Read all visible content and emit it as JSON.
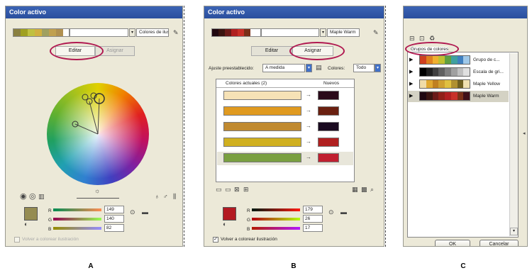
{
  "captions": {
    "a": "A",
    "b": "B",
    "c": "C"
  },
  "panelA": {
    "title": "Color activo",
    "group_name": "Colores de ilustra",
    "tab_edit": "Editar",
    "tab_assign": "Asignar",
    "r_label": "R",
    "g_label": "G",
    "b_label": "B",
    "r_value": "149",
    "g_value": "140",
    "b_value": "82",
    "recolor_label": "Volver a colorear ilustración",
    "base_color": "#958c52"
  },
  "panelB": {
    "title": "Color activo",
    "group_name": "Maple Warm",
    "tab_edit": "Editar",
    "tab_assign": "Asignar",
    "preset_label": "Ajuste preestablecido:",
    "preset_value": "A medida",
    "colors_label": "Colores:",
    "colors_value": "Todo",
    "col_current": "Colores actuales (2)",
    "col_new": "Nuevos",
    "rows": [
      {
        "current": "#f6e2b6",
        "new": "#2a0a1a"
      },
      {
        "current": "#e09a20",
        "new": "#6a2010"
      },
      {
        "current": "#c08a30",
        "new": "#1a0a20"
      },
      {
        "current": "#d0b020",
        "new": "#b02020"
      },
      {
        "current": "#7aa040",
        "new": "#c02030"
      }
    ],
    "r_label": "R",
    "g_label": "G",
    "b_label": "B",
    "r_value": "179",
    "g_value": "26",
    "b_value": "17",
    "recolor_label": "Volver a colorear ilustración",
    "base_color": "#b31a22"
  },
  "panelC": {
    "groups_label": "Grupos de colores",
    "groups": [
      {
        "name": "Grupo de c...",
        "colors": [
          "#d04020",
          "#e08020",
          "#f0b030",
          "#c0c030",
          "#60a040",
          "#40a0a0",
          "#4080c0",
          "#a0c8e8"
        ]
      },
      {
        "name": "Escala de gri...",
        "colors": [
          "#000000",
          "#202020",
          "#404040",
          "#606060",
          "#808080",
          "#a0a0a0",
          "#c0c0c0",
          "#e0e0e0"
        ]
      },
      {
        "name": "Maple Yellow",
        "colors": [
          "#f0dca8",
          "#e0a830",
          "#c08020",
          "#d0a030",
          "#e0c040",
          "#b09030",
          "#706020",
          "#f0e0b0"
        ]
      },
      {
        "name": "Maple Warm",
        "colors": [
          "#200810",
          "#3a1410",
          "#6a1a18",
          "#902018",
          "#b02020",
          "#c83028",
          "#7a3018",
          "#401018"
        ]
      }
    ],
    "ok_label": "OK",
    "cancel_label": "Cancelar"
  }
}
